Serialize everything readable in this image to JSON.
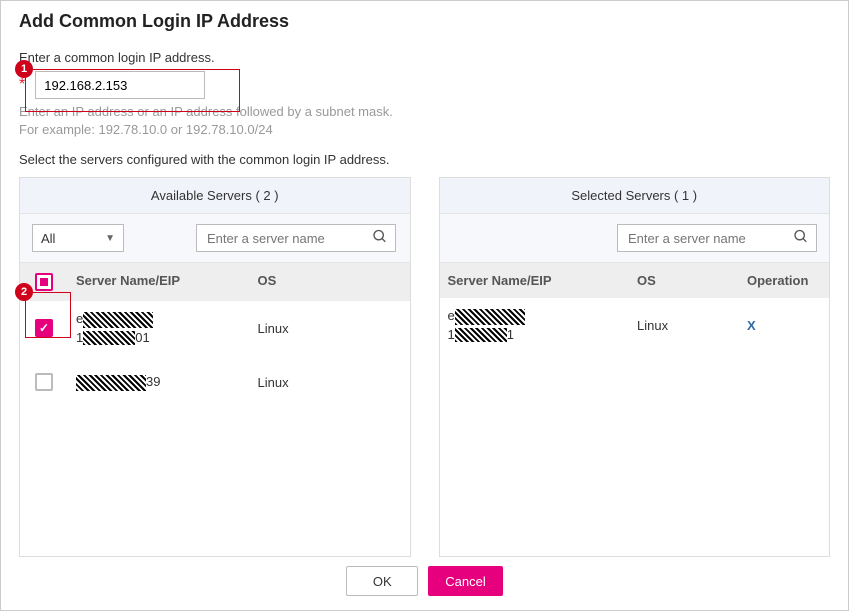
{
  "dialog": {
    "title": "Add Common Login IP Address",
    "instruction": "Enter a common login IP address.",
    "ip_value": "192.168.2.153",
    "helper_line1": "Enter an IP address or an IP address followed by a subnet mask.",
    "helper_line2": "For example: 192.78.10.0 or 192.78.10.0/24",
    "instruction2": "Select the servers configured with the common login IP address."
  },
  "available": {
    "title": "Available Servers ( 2 )",
    "filter_label": "All",
    "search_placeholder": "Enter a server name",
    "columns": {
      "name": "Server Name/EIP",
      "os": "OS"
    },
    "rows": [
      {
        "prefix": "e",
        "line2_prefix": "1",
        "line2_suffix": "01",
        "os": "Linux",
        "checked": true
      },
      {
        "prefix": "",
        "line2_prefix": "",
        "line2_suffix": "39",
        "os": "Linux",
        "checked": false
      }
    ]
  },
  "selected": {
    "title": "Selected Servers ( 1 )",
    "search_placeholder": "Enter a server name",
    "columns": {
      "name": "Server Name/EIP",
      "os": "OS",
      "op": "Operation"
    },
    "rows": [
      {
        "prefix": "e",
        "line2_prefix": "1",
        "line2_suffix": "1",
        "os": "Linux",
        "op": "X"
      }
    ]
  },
  "buttons": {
    "ok": "OK",
    "cancel": "Cancel"
  },
  "callouts": {
    "one": "1",
    "two": "2"
  }
}
